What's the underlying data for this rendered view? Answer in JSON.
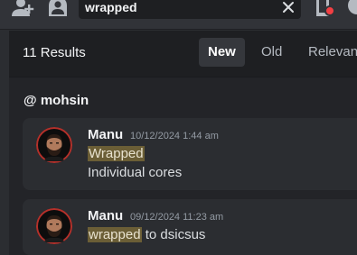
{
  "toolbar": {
    "add_member_icon": "person-add-icon",
    "user_profile_icon": "user-profile-icon",
    "inbox_icon": "inbox-icon",
    "help_icon": "help-icon"
  },
  "search": {
    "value": "wrapped",
    "clear_icon": "close-icon"
  },
  "results": {
    "count_label": "11 Results",
    "sort_tabs": [
      {
        "label": "New",
        "active": true
      },
      {
        "label": "Old",
        "active": false
      },
      {
        "label": "Relevance",
        "active": false
      }
    ]
  },
  "channel": {
    "at": "@",
    "name": "mohsin"
  },
  "messages": [
    {
      "author": "Manu",
      "timestamp": "10/12/2024 1:44 am",
      "line1_highlight": "Wrapped",
      "line1_rest": "",
      "line2": "Individual cores"
    },
    {
      "author": "Manu",
      "timestamp": "09/12/2024 11:23 am",
      "line1_highlight": "wrapped",
      "line1_rest": " to dsicsus",
      "line2": ""
    }
  ],
  "colors": {
    "background": "#2b2d31",
    "panel": "#232428",
    "header": "#1e1f22",
    "highlight": "#6b5e36",
    "notification": "#f23f43",
    "avatar_ring": "#c0392b"
  }
}
